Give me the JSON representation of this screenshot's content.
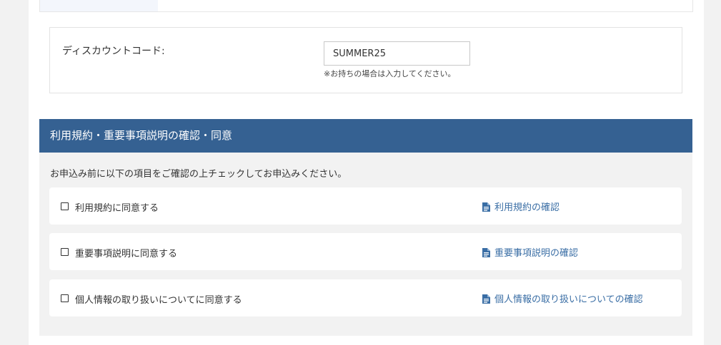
{
  "discount": {
    "label": "ディスカウントコード:",
    "value": "SUMMER25",
    "note": "※お持ちの場合は入力してください。"
  },
  "agreement": {
    "title": "利用規約・重要事項説明の確認・同意",
    "instruction": "お申込み前に以下の項目をご確認の上チェックしてお申込みください。",
    "items": [
      {
        "label": "利用規約に同意する",
        "checked": false,
        "link_label": "利用規約の確認",
        "link_icon": "document-icon"
      },
      {
        "label": "重要事項説明に同意する",
        "checked": false,
        "link_label": "重要事項説明の確認",
        "link_icon": "document-icon"
      },
      {
        "label": "個人情報の取り扱いについてに同意する",
        "checked": false,
        "link_label": "個人情報の取り扱いについての確認",
        "link_icon": "document-icon"
      }
    ]
  },
  "colors": {
    "header_bg": "#356192",
    "link": "#3a6ea5",
    "section_bg": "#f2f2f2"
  }
}
